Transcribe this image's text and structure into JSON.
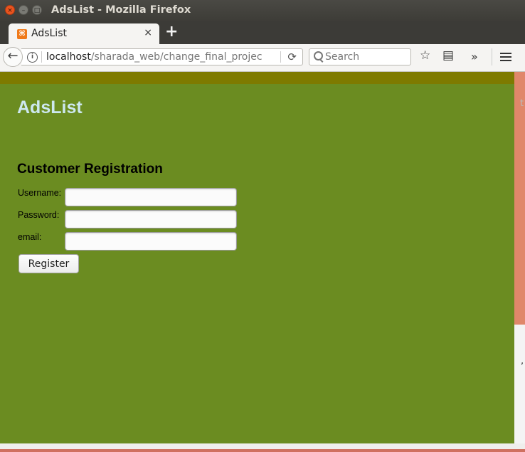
{
  "window": {
    "title": "AdsList - Mozilla Firefox",
    "close_glyph": "×",
    "minimize_glyph": "–",
    "maximize_glyph": "□"
  },
  "tab": {
    "title": "AdsList",
    "favicon_glyph": "⌘",
    "close_glyph": "×",
    "new_tab_glyph": "+"
  },
  "navbar": {
    "back_glyph": "←",
    "url_host": "localhost",
    "url_path": "/sharada_web/change_final_projec",
    "reload_glyph": "⟳",
    "search_placeholder": "Search",
    "star_glyph": "☆",
    "reading_glyph": "▤",
    "overflow_glyph": "»"
  },
  "page": {
    "site_title": "AdsList",
    "form_heading": "Customer Registration",
    "username_label": "Username:",
    "password_label": "Password:",
    "email_label": "email:",
    "register_label": "Register",
    "right_glyph_top": "t",
    "right_glyph_bottom": ","
  },
  "colors": {
    "page_background": "#6b8c21",
    "top_stripe": "#7e7a00",
    "site_title": "#cde8f0",
    "window_close": "#e9541f"
  },
  "icons": [
    "close-icon",
    "minimize-icon",
    "maximize-icon",
    "xampp-favicon-icon",
    "tab-close-icon",
    "new-tab-icon",
    "back-arrow-icon",
    "info-icon",
    "reload-icon",
    "search-icon",
    "bookmark-star-icon",
    "reading-list-icon",
    "overflow-chevron-icon",
    "hamburger-menu-icon"
  ]
}
